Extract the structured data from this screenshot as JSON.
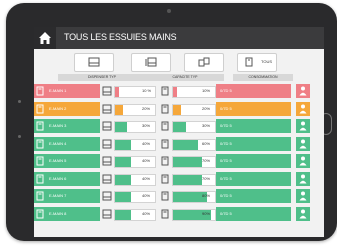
{
  "header": {
    "title": "TOUS LES ESSUIES MAINS"
  },
  "toolbar": {
    "buttons": [
      {
        "name": "single-dispenser",
        "label": ""
      },
      {
        "name": "double-dispenser",
        "label": ""
      },
      {
        "name": "group-dispenser",
        "label": ""
      },
      {
        "name": "all-dispensers",
        "label": "TOUS"
      }
    ]
  },
  "columns": {
    "dispenser": "DISPENSER TYP",
    "capacity": "CAPACITE TYP",
    "consumption": "CONSOMMATION"
  },
  "rows": [
    {
      "status": "red",
      "name": "E-MAIN 1",
      "fill_pct": 10,
      "fill_label": "10 %",
      "cap_pct": 10,
      "cap_label": "10%",
      "conso": "0/7D   5"
    },
    {
      "status": "orange",
      "name": "E-MAIN 2",
      "fill_pct": 20,
      "fill_label": "20%",
      "cap_pct": 20,
      "cap_label": "20%",
      "conso": "0/7D   5"
    },
    {
      "status": "green",
      "name": "E-MAIN 3",
      "fill_pct": 30,
      "fill_label": "30%",
      "cap_pct": 30,
      "cap_label": "30%",
      "conso": "0/7D   5"
    },
    {
      "status": "green",
      "name": "E-MAIN 4",
      "fill_pct": 40,
      "fill_label": "40%",
      "cap_pct": 60,
      "cap_label": "60%",
      "conso": "0/7D   5"
    },
    {
      "status": "green",
      "name": "E-MAIN 5",
      "fill_pct": 40,
      "fill_label": "40%",
      "cap_pct": 70,
      "cap_label": "70%",
      "conso": "0/7D   5"
    },
    {
      "status": "green",
      "name": "E-MAIN 6",
      "fill_pct": 40,
      "fill_label": "40%",
      "cap_pct": 70,
      "cap_label": "70%",
      "conso": "0/7D   5"
    },
    {
      "status": "green",
      "name": "E-MAIN 7",
      "fill_pct": 40,
      "fill_label": "40%",
      "cap_pct": 80,
      "cap_label": "80%",
      "conso": "0/7D   5"
    },
    {
      "status": "green",
      "name": "E-MAIN 8",
      "fill_pct": 40,
      "fill_label": "40%",
      "cap_pct": 90,
      "cap_label": "90%",
      "conso": "0/7D   5"
    }
  ],
  "colors": {
    "red": "#ef7f86",
    "orange": "#f5a73a",
    "green": "#4fbf8a",
    "bar_green": "#4fbf8a",
    "bar_red": "#ef7f86",
    "bar_orange": "#f5a73a"
  },
  "icons": {
    "home": "home-icon",
    "dispenser": "hand-dryer-icon",
    "person": "person-icon"
  }
}
